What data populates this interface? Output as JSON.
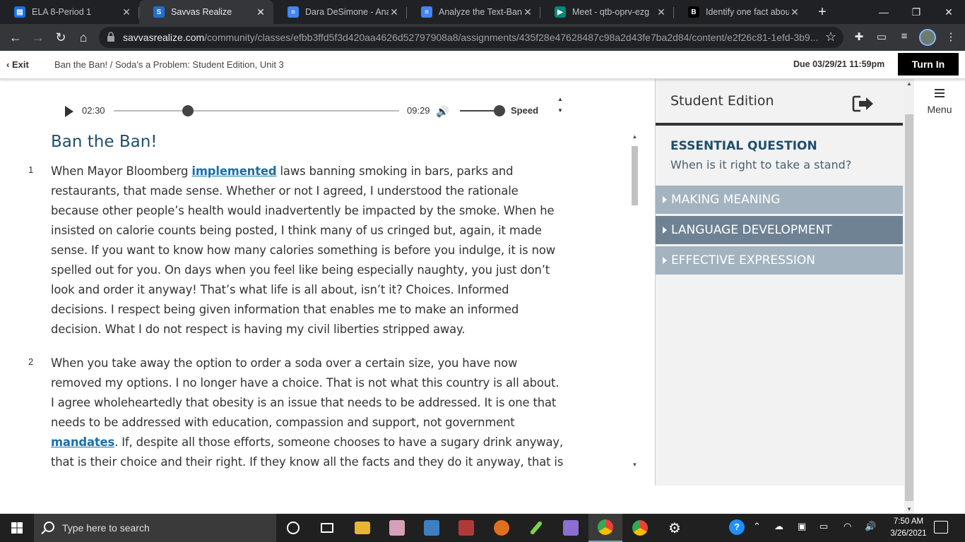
{
  "browser": {
    "tabs": [
      {
        "title": "ELA 8-Period 1",
        "active": false,
        "favicon": "google-classroom-icon",
        "color": "#1a73e8"
      },
      {
        "title": "Savvas Realize",
        "active": true,
        "favicon": "savvas-icon",
        "color": "#1f6fd1"
      },
      {
        "title": "Dara DeSimone - Analy",
        "active": false,
        "favicon": "google-docs-icon",
        "color": "#4285f4"
      },
      {
        "title": "Analyze the Text-Ban th",
        "active": false,
        "favicon": "google-docs-icon",
        "color": "#4285f4"
      },
      {
        "title": "Meet - qtb-oprv-ezg",
        "active": false,
        "favicon": "google-meet-icon",
        "color": "#00897b"
      },
      {
        "title": "Identify one fact about",
        "active": false,
        "favicon": "brainly-icon",
        "color": "#000000"
      }
    ],
    "new_tab": "+",
    "url_domain": "savvasrealize.com",
    "url_path": "/community/classes/efbb3ffd5f3d420aa4626d52797908a8/assignments/435f28e47628487c98a2d43fe7ba2d84/content/e2f26c81-1efd-3b9..."
  },
  "header": {
    "exit_label": "Exit",
    "breadcrumb": "Ban the Ban! / Soda's a Problem: Student Edition, Unit 3",
    "due": "Due 03/29/21 11:59pm",
    "turn_in": "Turn In"
  },
  "player": {
    "elapsed": "02:30",
    "duration": "09:29",
    "progress_fraction": 0.26,
    "volume_fraction": 1.0,
    "speed_label": "Speed"
  },
  "article": {
    "title": "Ban the Ban!",
    "paragraphs": [
      {
        "number": "1",
        "before": "When Mayor Bloomberg ",
        "vocab": "implemented",
        "after": " laws banning smoking in bars, parks and restaurants, that made sense. Whether or not I agreed, I understood the rationale because other people’s health would inadvertently be impacted by the smoke. When he insisted on calorie counts being posted, I think many of us cringed but, again, it made sense. If you want to know how many calories something is before you indulge, it is now spelled out for you. On days when you feel like being especially naughty, you just don’t look and order it anyway! That’s what life is all about, isn’t it? Choices. Informed decisions. I respect being given information that enables me to make an informed decision. What I do not respect is having my civil liberties stripped away."
      },
      {
        "number": "2",
        "before": "When you take away the option to order a soda over a certain size, you have now removed my options. I no longer have a choice. That is not what this country is all about. I agree wholeheartedly that obesity is an issue that needs to be addressed. It is one that needs to be addressed with education, compassion and support, not government ",
        "vocab": "mandates",
        "after": ". If, despite all those efforts, someone chooses to have a sugary drink anyway, that is their choice and their right. If they know all the facts and they do it anyway, that is a personal"
      }
    ]
  },
  "side_panel": {
    "title": "Student Edition",
    "essential_label": "ESSENTIAL QUESTION",
    "essential_question": "When is it right to take a stand?",
    "sections": [
      {
        "label": "MAKING MEANING",
        "color": "#a3b3c0"
      },
      {
        "label": "LANGUAGE DEVELOPMENT",
        "color": "#6e8294"
      },
      {
        "label": "EFFECTIVE EXPRESSION",
        "color": "#a3b3c0"
      }
    ],
    "menu_label": "Menu"
  },
  "taskbar": {
    "search_placeholder": "Type here to search",
    "time": "7:50 AM",
    "date": "3/26/2021"
  }
}
